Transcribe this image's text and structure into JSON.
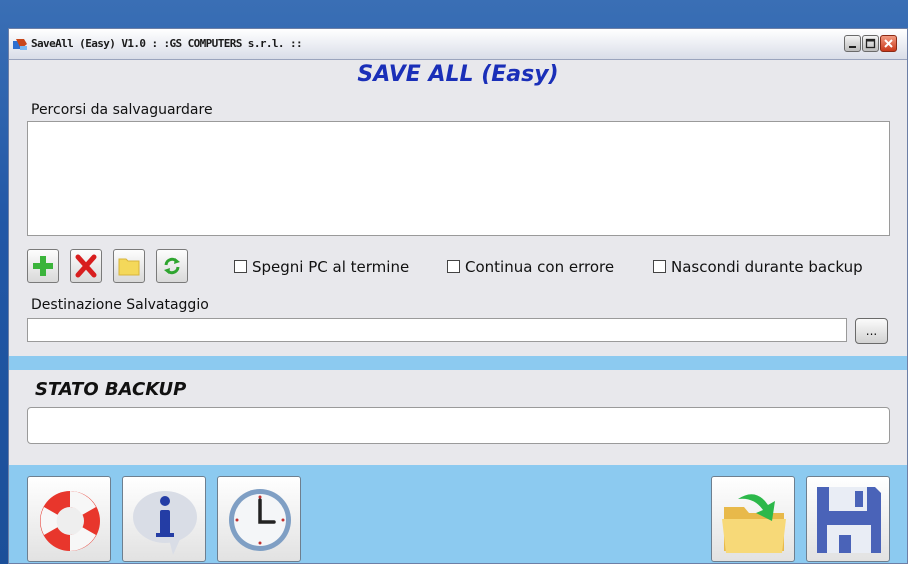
{
  "window": {
    "title": "SaveAll (Easy) V1.0  : :GS COMPUTERS s.r.l. ::",
    "controls": [
      "minimize-icon",
      "maximize-icon",
      "close-icon"
    ]
  },
  "app_title": "SAVE ALL (Easy)",
  "paths_section": {
    "label": "Percorsi da salvaguardare",
    "items": []
  },
  "toolbar": {
    "buttons": [
      "add-icon",
      "delete-icon",
      "folder-icon",
      "refresh-icon"
    ]
  },
  "options": [
    {
      "label": "Spegni PC al termine",
      "checked": false
    },
    {
      "label": "Continua con errore",
      "checked": false
    },
    {
      "label": "Nascondi durante backup",
      "checked": false
    }
  ],
  "destination": {
    "label": "Destinazione Salvataggio",
    "value": "",
    "browse_label": "..."
  },
  "status": {
    "title": "STATO BACKUP",
    "value": ""
  },
  "bottom_buttons": [
    "lifebuoy-icon",
    "info-icon",
    "clock-icon",
    "open-folder-icon",
    "save-floppy-icon"
  ],
  "colors": {
    "app_title": "#1a2fb8",
    "band": "#8ccaf0",
    "desktop": "#2257a6"
  }
}
